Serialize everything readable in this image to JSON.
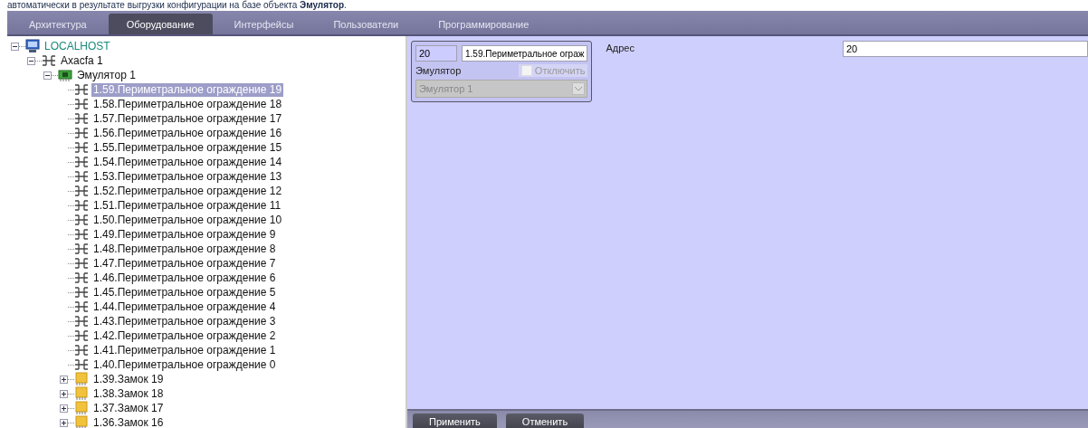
{
  "caption": "автоматически в результате выгрузки конфигурации на базе объекта **Эмулятор**.",
  "tabs": [
    {
      "label": "Архитектура",
      "selected": false
    },
    {
      "label": "Оборудование",
      "selected": true
    },
    {
      "label": "Интерфейсы",
      "selected": false
    },
    {
      "label": "Пользователи",
      "selected": false
    },
    {
      "label": "Программирование",
      "selected": false
    }
  ],
  "tree": [
    {
      "label": "LOCALHOST",
      "kind": "computer",
      "expanded": true,
      "selected": false,
      "children": [
        {
          "label": "Axacfa 1",
          "kind": "hub",
          "expanded": true,
          "selected": false,
          "children": [
            {
              "label": "Эмулятор 1",
              "kind": "board",
              "expanded": true,
              "selected": false,
              "children": [
                {
                  "label": "1.59.Периметральное ограждение 19",
                  "kind": "fence",
                  "selected": true
                },
                {
                  "label": "1.58.Периметральное ограждение 18",
                  "kind": "fence",
                  "selected": false
                },
                {
                  "label": "1.57.Периметральное ограждение 17",
                  "kind": "fence",
                  "selected": false
                },
                {
                  "label": "1.56.Периметральное ограждение 16",
                  "kind": "fence",
                  "selected": false
                },
                {
                  "label": "1.55.Периметральное ограждение 15",
                  "kind": "fence",
                  "selected": false
                },
                {
                  "label": "1.54.Периметральное ограждение 14",
                  "kind": "fence",
                  "selected": false
                },
                {
                  "label": "1.53.Периметральное ограждение 13",
                  "kind": "fence",
                  "selected": false
                },
                {
                  "label": "1.52.Периметральное ограждение 12",
                  "kind": "fence",
                  "selected": false
                },
                {
                  "label": "1.51.Периметральное ограждение 11",
                  "kind": "fence",
                  "selected": false
                },
                {
                  "label": "1.50.Периметральное ограждение 10",
                  "kind": "fence",
                  "selected": false
                },
                {
                  "label": "1.49.Периметральное ограждение 9",
                  "kind": "fence",
                  "selected": false
                },
                {
                  "label": "1.48.Периметральное ограждение 8",
                  "kind": "fence",
                  "selected": false
                },
                {
                  "label": "1.47.Периметральное ограждение 7",
                  "kind": "fence",
                  "selected": false
                },
                {
                  "label": "1.46.Периметральное ограждение 6",
                  "kind": "fence",
                  "selected": false
                },
                {
                  "label": "1.45.Периметральное ограждение 5",
                  "kind": "fence",
                  "selected": false
                },
                {
                  "label": "1.44.Периметральное ограждение 4",
                  "kind": "fence",
                  "selected": false
                },
                {
                  "label": "1.43.Периметральное ограждение 3",
                  "kind": "fence",
                  "selected": false
                },
                {
                  "label": "1.42.Периметральное ограждение 2",
                  "kind": "fence",
                  "selected": false
                },
                {
                  "label": "1.41.Периметральное ограждение 1",
                  "kind": "fence",
                  "selected": false
                },
                {
                  "label": "1.40.Периметральное ограждение 0",
                  "kind": "fence",
                  "selected": false
                },
                {
                  "label": "1.39.Замок 19",
                  "kind": "lock",
                  "expanded": false,
                  "selected": false
                },
                {
                  "label": "1.38.Замок 18",
                  "kind": "lock",
                  "expanded": false,
                  "selected": false
                },
                {
                  "label": "1.37.Замок 17",
                  "kind": "lock",
                  "expanded": false,
                  "selected": false
                },
                {
                  "label": "1.36.Замок 16",
                  "kind": "lock",
                  "expanded": false,
                  "selected": false
                }
              ]
            }
          ]
        }
      ]
    }
  ],
  "properties": {
    "number": "20",
    "name": "1.59.Периметральное ограж",
    "type_label": "Эмулятор",
    "disable": {
      "label": "Отключить",
      "checked": false,
      "disabled": true
    },
    "parent": {
      "value": "Эмулятор 1",
      "disabled": true
    },
    "address": {
      "label": "Адрес",
      "value": "20"
    }
  },
  "buttons": [
    "Применить",
    "Отменить"
  ]
}
